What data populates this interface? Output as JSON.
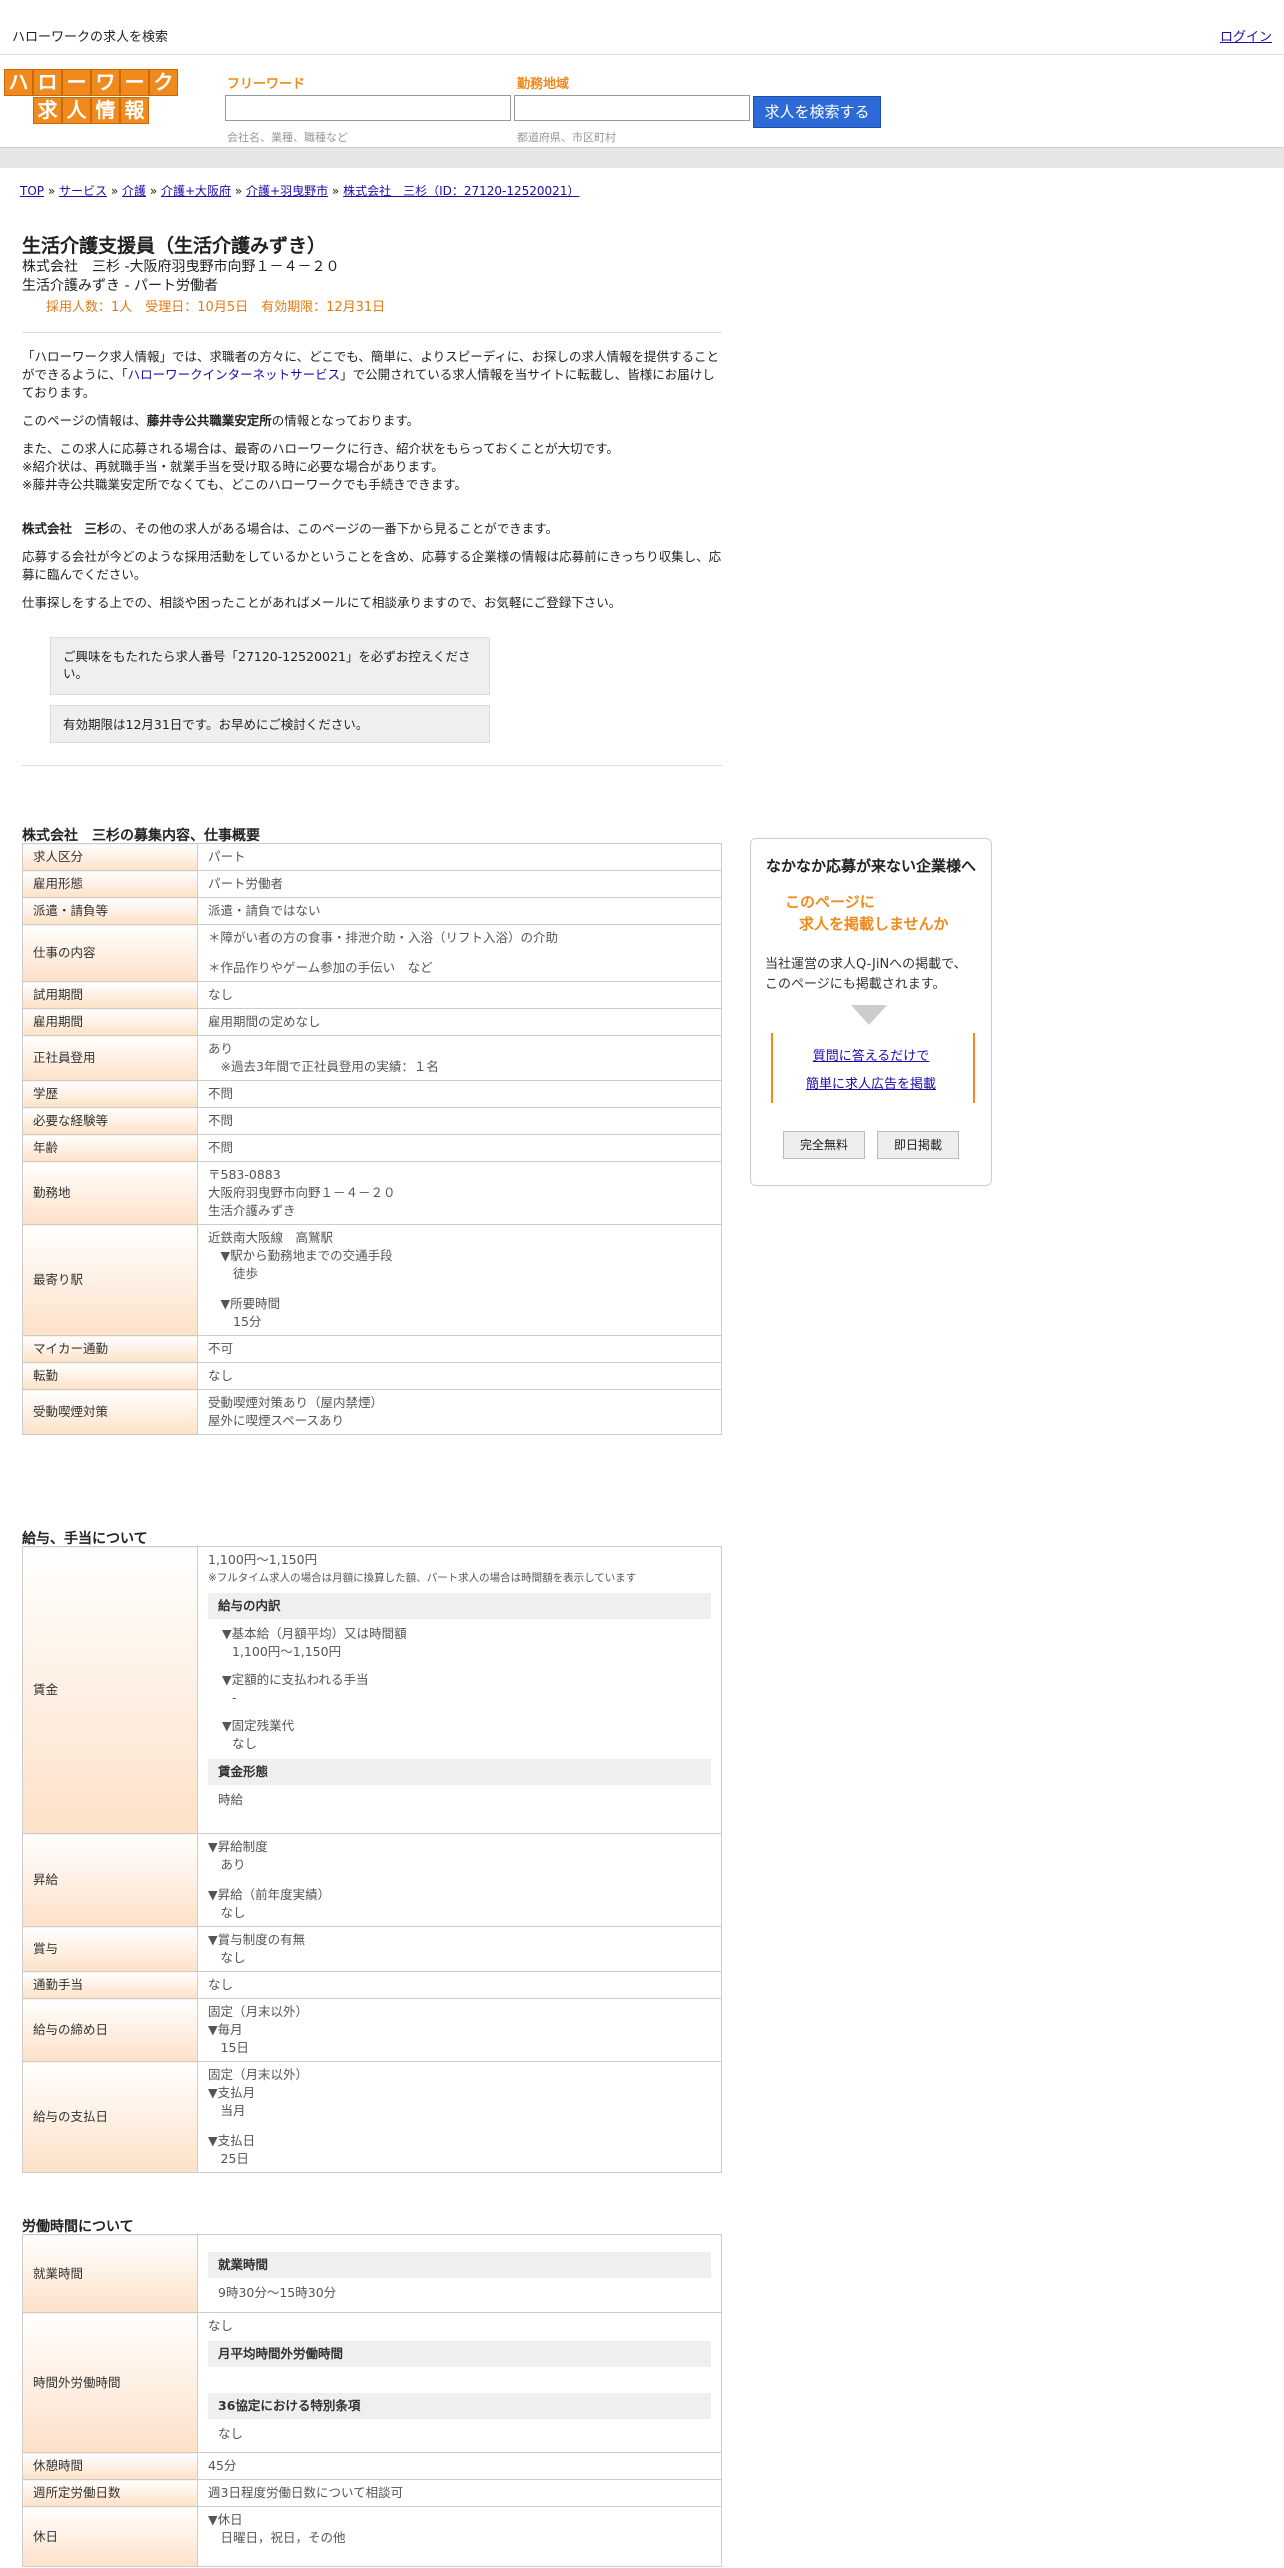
{
  "topbar": {
    "site": "ハローワークの求人を検索",
    "login": "ログイン"
  },
  "logo": {
    "row1": [
      "ハ",
      "ロ",
      "ー",
      "ワ",
      "ー",
      "ク"
    ],
    "row2": [
      "求",
      "人",
      "情",
      "報"
    ]
  },
  "search": {
    "keyword_label": "フリーワード",
    "keyword_hint": "会社名、業種、職種など",
    "area_label": "勤務地域",
    "area_hint": "都道府県、市区町村",
    "button": "求人を検索する"
  },
  "breadcrumb": {
    "items": [
      "TOP",
      "サービス",
      "介護",
      "介護+大阪府",
      "介護+羽曳野市",
      "株式会社　三杉（ID：27120-12520021）"
    ],
    "sep": " » "
  },
  "job": {
    "title": "生活介護支援員（生活介護みずき）",
    "company_address": "株式会社　三杉 -大阪府羽曳野市向野１－４－２０",
    "employment": "生活介護みずき - パート労働者",
    "meta": "採用人数：1人　受理日：10月5日　有効期限：12月31日"
  },
  "intro": {
    "p1a": "「ハローワーク求人情報」では、求職者の方々に、どこでも、簡単に、よりスピーディに、お探しの求人情報を提供することができるように、「",
    "p1link": "ハローワークインターネットサービス",
    "p1b": "」で公開されている求人情報を当サイトに転載し、皆様にお届けしております。",
    "p2a": "このページの情報は、",
    "p2b": "藤井寺公共職業安定所",
    "p2c": "の情報となっております。",
    "p3": "また、この求人に応募される場合は、最寄のハローワークに行き、紹介状をもらっておくことが大切です。",
    "p4": "※紹介状は、再就職手当・就業手当を受け取る時に必要な場合があります。",
    "p5": "※藤井寺公共職業安定所でなくても、どこのハローワークでも手続きできます。",
    "p6a": "株式会社　三杉",
    "p6b": "の、その他の求人がある場合は、このページの一番下から見ることができます。",
    "p7": "応募する会社が今どのような採用活動をしているかということを含め、応募する企業様の情報は応募前にきっちり収集し、応募に臨んでください。",
    "p8": "仕事探しをする上での、相談や困ったことがあればメールにて相談承りますので、お気軽にご登録下さい。"
  },
  "notices": [
    "ご興味をもたれたら求人番号「27120-12520021」を必ずお控えください。",
    "有効期限は12月31日です。お早めにご検討ください。"
  ],
  "section1": {
    "title": "株式会社　三杉の募集内容、仕事概要",
    "rows": [
      {
        "label": "求人区分",
        "lines": [
          "パート"
        ]
      },
      {
        "label": "雇用形態",
        "lines": [
          "パート労働者"
        ]
      },
      {
        "label": "派遣・請負等",
        "lines": [
          "派遣・請負ではない"
        ]
      },
      {
        "label": "仕事の内容",
        "lines": [
          "＊障がい者の方の食事・排泄介助・入浴（リフト入浴）の介助",
          "",
          "＊作品作りやゲーム参加の手伝い　など"
        ]
      },
      {
        "label": "試用期間",
        "lines": [
          "なし"
        ]
      },
      {
        "label": "雇用期間",
        "lines": [
          "雇用期間の定めなし"
        ]
      },
      {
        "label": "正社員登用",
        "lines": [
          "あり",
          "　※過去3年間で正社員登用の実績：１名"
        ]
      },
      {
        "label": "学歴",
        "lines": [
          "不問"
        ]
      },
      {
        "label": "必要な経験等",
        "lines": [
          "不問"
        ]
      },
      {
        "label": "年齢",
        "lines": [
          "不問"
        ]
      },
      {
        "label": "勤務地",
        "lines": [
          "〒583-0883",
          "大阪府羽曳野市向野１－４－２０",
          "生活介護みずき"
        ]
      },
      {
        "label": "最寄り駅",
        "lines": [
          "近鉄南大阪線　高鷲駅",
          "　▼駅から勤務地までの交通手段",
          "　　徒歩",
          "",
          "　▼所要時間",
          "　　15分"
        ]
      },
      {
        "label": "マイカー通勤",
        "lines": [
          "不可"
        ]
      },
      {
        "label": "転勤",
        "lines": [
          "なし"
        ]
      },
      {
        "label": "受動喫煙対策",
        "lines": [
          "受動喫煙対策あり（屋内禁煙）",
          "屋外に喫煙スペースあり"
        ]
      }
    ]
  },
  "section2": {
    "title": "給与、手当について",
    "wage_label": "賃金",
    "wage_range": "1,100円〜1,150円",
    "wage_note": "※フルタイム求人の場合は月額に換算した額、パート求人の場合は時間額を表示しています",
    "wage_breakdown": "給与の内訳",
    "base_label": "▼基本給（月額平均）又は時間額",
    "base_value": "1,100円〜1,150円",
    "fixed_label": "▼定額的に支払われる手当",
    "fixed_value": "-",
    "ot_label": "▼固定残業代",
    "ot_value": "なし",
    "wage_type_h": "賃金形態",
    "wage_type": "時給",
    "rows": [
      {
        "label": "昇給",
        "lines": [
          "▼昇給制度",
          "　あり",
          "",
          "▼昇給（前年度実績）",
          "　なし"
        ]
      },
      {
        "label": "賞与",
        "lines": [
          "▼賞与制度の有無",
          "　なし"
        ]
      },
      {
        "label": "通勤手当",
        "lines": [
          "なし"
        ]
      },
      {
        "label": "給与の締め日",
        "lines": [
          "固定（月末以外）",
          "▼毎月",
          "　15日"
        ]
      },
      {
        "label": "給与の支払日",
        "lines": [
          "固定（月末以外）",
          "▼支払月",
          "　当月",
          "",
          "▼支払日",
          "　25日"
        ]
      }
    ]
  },
  "section3": {
    "title": "労働時間について",
    "work_hours_label": "就業時間",
    "work_hours_h": "就業時間",
    "work_hours": "9時30分〜15時30分",
    "overtime_label": "時間外労働時間",
    "overtime_value": "なし",
    "overtime_avg_h": "月平均時間外労働時間",
    "agreement_h": "36協定における特別条項",
    "agreement_value": "なし",
    "break_label": "休憩時間",
    "break_value": "45分",
    "days_label": "週所定労働日数",
    "days_value": "週3日程度労働日数について相談可",
    "holiday_label": "休日",
    "holiday_l1": "▼休日",
    "holiday_l2": "　日曜日，祝日，その他"
  },
  "sidebar": {
    "heading": "なかなか応募が来ない企業様へ",
    "orange1": "このページに",
    "orange2": "求人を掲載しませんか",
    "text1": "当社運営の求人Q-JiNへの掲載で、",
    "text2": "このページにも掲載されます。",
    "link1": "質問に答えるだけで",
    "link2": "簡単に求人広告を掲載",
    "btn1": "完全無料",
    "btn2": "即日掲載"
  },
  "colors": {
    "accent": "#f08a1c",
    "button": "#2d6ad8",
    "label_bg": "#fde1c8"
  }
}
